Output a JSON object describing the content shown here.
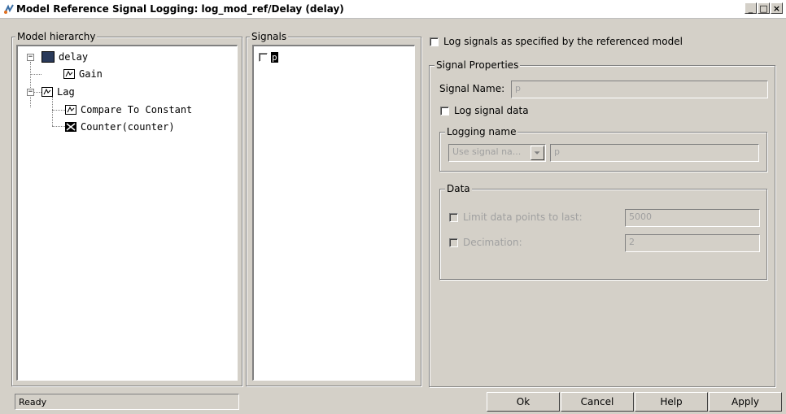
{
  "window": {
    "title": "Model Reference Signal Logging: log_mod_ref/Delay (delay)",
    "controls": [
      "_",
      "□",
      "×"
    ]
  },
  "hierarchy": {
    "label": "Model hierarchy",
    "nodes": [
      {
        "label": "delay",
        "icon": "model-icon",
        "expander": "−"
      },
      {
        "label": "Gain",
        "icon": "subsystem-icon"
      },
      {
        "label": "Lag",
        "icon": "subsystem-icon",
        "expander": "−"
      },
      {
        "label": "Compare To Constant",
        "icon": "subsystem-icon"
      },
      {
        "label": "Counter(counter)",
        "icon": "model-reference-icon"
      }
    ]
  },
  "signals": {
    "label": "Signals",
    "items": [
      {
        "label": "p",
        "checked": false
      }
    ]
  },
  "options": {
    "log_as_referenced": "Log signals as specified by the referenced model",
    "signal_properties": {
      "label": "Signal Properties",
      "signal_name_label": "Signal Name:",
      "signal_name_value": "p",
      "log_signal_data": "Log signal data",
      "logging_name": {
        "label": "Logging name",
        "select_value": "Use signal na...",
        "name_value": "p"
      },
      "data": {
        "label": "Data",
        "limit_label": "Limit data points to last:",
        "limit_value": "5000",
        "decimation_label": "Decimation:",
        "decimation_value": "2"
      }
    }
  },
  "status": "Ready",
  "buttons": {
    "ok": "Ok",
    "cancel": "Cancel",
    "help": "Help",
    "apply": "Apply"
  }
}
